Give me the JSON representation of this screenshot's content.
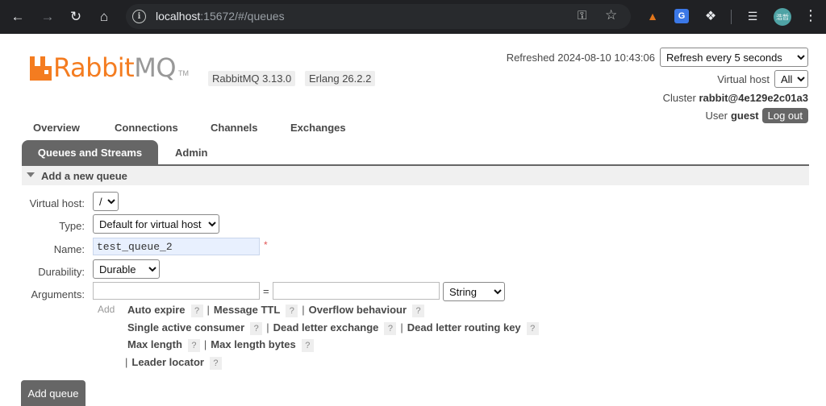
{
  "browser": {
    "url_host": "localhost",
    "url_rest": ":15672/#/queues",
    "avatar_text": "浩哲",
    "translate_glyph": "G"
  },
  "header": {
    "logo_rabbit": "Rabbit",
    "logo_mq": "MQ",
    "logo_tm": "TM",
    "version": "RabbitMQ 3.13.0",
    "erlang": "Erlang 26.2.2",
    "refreshed_label": "Refreshed 2024-08-10 10:43:06",
    "refresh_select": "Refresh every 5 seconds",
    "vhost_label": "Virtual host",
    "vhost_select": "All",
    "cluster_label": "Cluster",
    "cluster_name": "rabbit@4e129e2c01a3",
    "user_label": "User",
    "user_name": "guest",
    "logout": "Log out"
  },
  "nav": {
    "overview": "Overview",
    "connections": "Connections",
    "channels": "Channels",
    "exchanges": "Exchanges",
    "queues": "Queues and Streams",
    "admin": "Admin"
  },
  "section": {
    "title": "Add a new queue"
  },
  "form": {
    "vhost_label": "Virtual host:",
    "vhost_value": "/",
    "type_label": "Type:",
    "type_value": "Default for virtual host",
    "name_label": "Name:",
    "name_value": "test_queue_2",
    "required_mark": "*",
    "durability_label": "Durability:",
    "durability_value": "Durable",
    "arguments_label": "Arguments:",
    "arg_key": "",
    "arg_value": "",
    "equals": "=",
    "arg_type": "String",
    "add_label": "Add",
    "help_glyph": "?",
    "pipe": "|",
    "args": {
      "auto_expire": "Auto expire",
      "message_ttl": "Message TTL",
      "overflow": "Overflow behaviour",
      "single_active": "Single active consumer",
      "dl_exchange": "Dead letter exchange",
      "dl_routing": "Dead letter routing key",
      "max_length": "Max length",
      "max_length_bytes": "Max length bytes",
      "leader_locator": "Leader locator"
    },
    "submit": "Add queue"
  }
}
